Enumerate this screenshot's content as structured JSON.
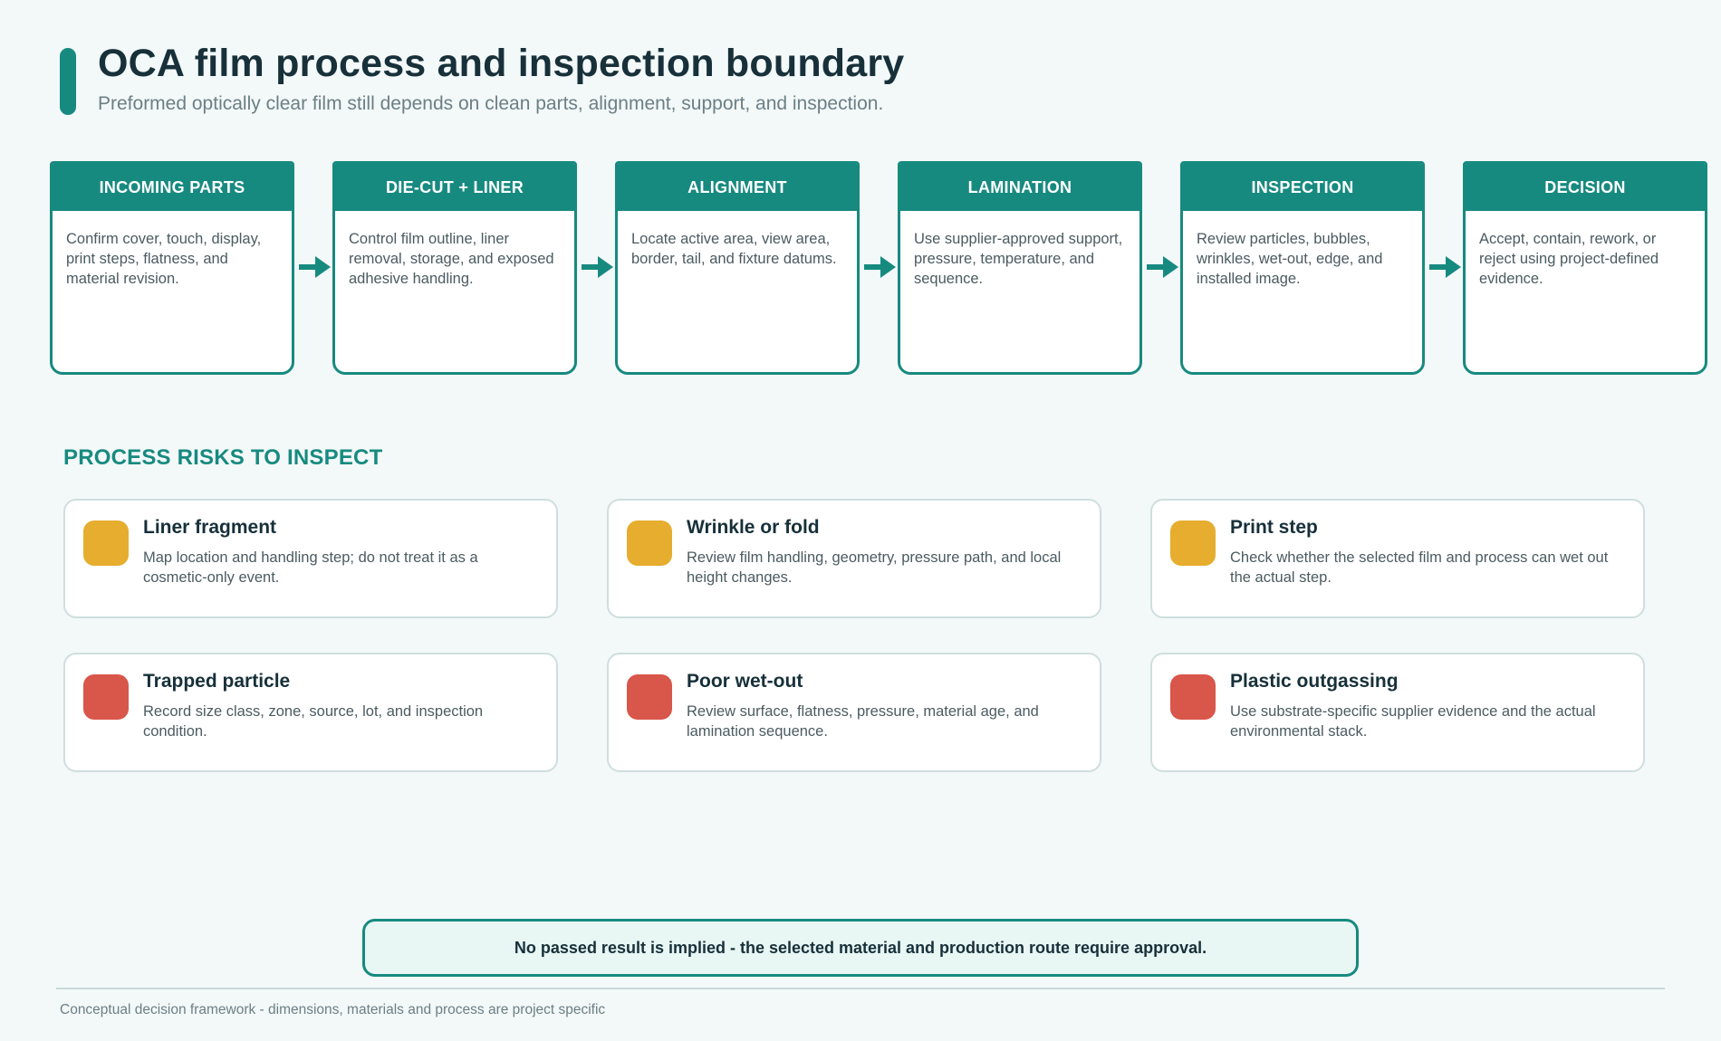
{
  "header": {
    "title": "OCA film process and inspection boundary",
    "subtitle": "Preformed optically clear film still depends on clean parts, alignment, support, and inspection."
  },
  "colors": {
    "accent": "#178a80",
    "warning": "#e6ad2e",
    "danger": "#d9564a"
  },
  "flow": {
    "steps": [
      {
        "title": "INCOMING PARTS",
        "text": "Confirm cover, touch, display, print steps, flatness, and material revision."
      },
      {
        "title": "DIE-CUT + LINER",
        "text": "Control film outline, liner removal, storage, and exposed adhesive handling."
      },
      {
        "title": "ALIGNMENT",
        "text": "Locate active area, view area, border, tail, and fixture datums."
      },
      {
        "title": "LAMINATION",
        "text": "Use supplier-approved support, pressure, temperature, and sequence."
      },
      {
        "title": "INSPECTION",
        "text": "Review particles, bubbles, wrinkles, wet-out, edge, and installed image."
      },
      {
        "title": "DECISION",
        "text": "Accept, contain, rework, or reject using project-defined evidence."
      }
    ]
  },
  "risks": {
    "heading": "PROCESS RISKS TO INSPECT",
    "items": [
      {
        "title": "Liner fragment",
        "text": "Map location and handling step; do not treat it as a cosmetic-only event.",
        "severity": "warning"
      },
      {
        "title": "Wrinkle or fold",
        "text": "Review film handling, geometry, pressure path, and local height changes.",
        "severity": "warning"
      },
      {
        "title": "Print step",
        "text": "Check whether the selected film and process can wet out the actual step.",
        "severity": "warning"
      },
      {
        "title": "Trapped particle",
        "text": "Record size class, zone, source, lot, and inspection condition.",
        "severity": "danger"
      },
      {
        "title": "Poor wet-out",
        "text": "Review surface, flatness, pressure, material age, and lamination sequence.",
        "severity": "danger"
      },
      {
        "title": "Plastic outgassing",
        "text": "Use substrate-specific supplier evidence and the actual environmental stack.",
        "severity": "danger"
      }
    ]
  },
  "note": "No passed result is implied - the selected material and production route require approval.",
  "footer": "Conceptual decision framework - dimensions, materials and process are project specific"
}
